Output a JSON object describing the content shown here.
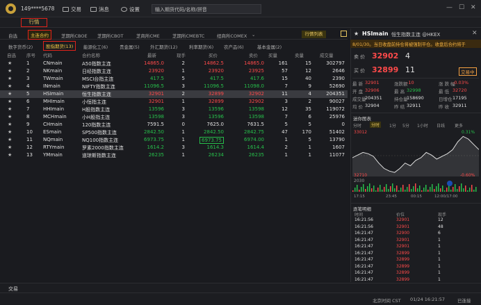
{
  "top": {
    "account": "149****5678",
    "trade": "交易",
    "message": "消息",
    "settings": "设置",
    "search_placeholder": "输入期货代码/名称/拼音"
  },
  "tab_main": "行情",
  "exchanges": [
    "自选",
    "主连合约",
    "芝期所CBOE",
    "芝期所CBOT",
    "芝商所CME",
    "芝期所CMEBTC",
    "纽商所COMEX"
  ],
  "list_label": "行情列表",
  "categories": [
    "数字货币(2)",
    "股指期货(13)",
    "能源化工(6)",
    "贵金属(5)",
    "外汇期货(12)",
    "利率期货(6)",
    "农产品(6)",
    "基本金属(2)"
  ],
  "headers": [
    "自选",
    "序号",
    "代码",
    "合约名称",
    "最新",
    "现手",
    "买价",
    "卖价",
    "买量",
    "卖量",
    "成交量"
  ],
  "rows": [
    {
      "no": "1",
      "code": "CNmain",
      "name": "A50指数主连",
      "last": "14865.0",
      "lc": "red",
      "hand": "2",
      "bid": "14862.5",
      "ask": "14865.0",
      "bq": "161",
      "aq": "15",
      "vol": "302797"
    },
    {
      "no": "2",
      "code": "NKmain",
      "name": "日经指数主连",
      "last": "23920",
      "lc": "red",
      "hand": "1",
      "bid": "23920",
      "ask": "23925",
      "bq": "57",
      "aq": "12",
      "vol": "2646"
    },
    {
      "no": "3",
      "code": "TWmain",
      "name": "MSCI台指主连",
      "last": "417.5",
      "lc": "grn",
      "hand": "5",
      "bid": "417.5",
      "ask": "417.6",
      "bq": "15",
      "aq": "40",
      "vol": "2390"
    },
    {
      "no": "4",
      "code": "INmain",
      "name": "NIFTY指数主连",
      "last": "11096.5",
      "lc": "grn",
      "hand": "3",
      "bid": "11096.5",
      "ask": "11098.0",
      "bq": "7",
      "aq": "9",
      "vol": "52690"
    },
    {
      "no": "5",
      "code": "HSImain",
      "name": "恒生指数主连",
      "last": "32901",
      "lc": "red",
      "hand": "2",
      "bid": "32899",
      "ask": "32902",
      "bq": "11",
      "aq": "4",
      "vol": "204351"
    },
    {
      "no": "6",
      "code": "MHImain",
      "name": "小恒指主连",
      "last": "32901",
      "lc": "red",
      "hand": "1",
      "bid": "32899",
      "ask": "32902",
      "bq": "3",
      "aq": "2",
      "vol": "90027"
    },
    {
      "no": "7",
      "code": "HHImain",
      "name": "H股指数主连",
      "last": "13596",
      "lc": "grn",
      "hand": "3",
      "bid": "13596",
      "ask": "13598",
      "bq": "12",
      "aq": "35",
      "vol": "119072"
    },
    {
      "no": "8",
      "code": "MCHmain",
      "name": "小H股指主连",
      "last": "13598",
      "lc": "grn",
      "hand": "3",
      "bid": "13596",
      "ask": "13598",
      "bq": "7",
      "aq": "6",
      "vol": "25976"
    },
    {
      "no": "9",
      "code": "CHmain",
      "name": "120指数主连",
      "last": "7591.5",
      "lc": "wht",
      "hand": "0",
      "bid": "7625.0",
      "ask": "7631.5",
      "bq": "5",
      "aq": "5",
      "vol": "0"
    },
    {
      "no": "10",
      "code": "ESmain",
      "name": "SP500指数主连",
      "last": "2842.50",
      "lc": "grn",
      "hand": "1",
      "bid": "2842.50",
      "ask": "2842.75",
      "bq": "47",
      "aq": "170",
      "vol": "51402"
    },
    {
      "no": "11",
      "code": "NQmain",
      "name": "NQ100指数主连",
      "last": "6973.75",
      "lc": "grn",
      "hand": "1",
      "bid": "6973.75",
      "ask": "6974.00",
      "bq": "1",
      "aq": "5",
      "vol": "13790"
    },
    {
      "no": "12",
      "code": "RTYmain",
      "name": "罗素2000指数主连",
      "last": "1614.2",
      "lc": "grn",
      "hand": "3",
      "bid": "1614.3",
      "ask": "1614.4",
      "bq": "2",
      "aq": "1",
      "vol": "1607"
    },
    {
      "no": "13",
      "code": "YMmain",
      "name": "道琼斯指数主连",
      "last": "26235",
      "lc": "grn",
      "hand": "1",
      "bid": "26234",
      "ask": "26235",
      "bq": "1",
      "aq": "1",
      "vol": "11077"
    }
  ],
  "right": {
    "code": "HSImain",
    "name": "恒生指数主连 @HKEX",
    "notice": "8/01/30。当日收盘前持仓将被强制平仓。收盘后合约将于",
    "sell_label": "卖 价",
    "sell": "32902",
    "sell_q": "4",
    "buy_label": "买 价",
    "buy": "32899",
    "buy_q": "11",
    "trade_btn": "交易中",
    "stats": [
      [
        "最 新",
        "32901",
        "涨跌额",
        "-10",
        "涨 跌 幅",
        "-0.03%"
      ],
      [
        "开 盘",
        "32906",
        "最 高",
        "32998",
        "最 低",
        "32720"
      ],
      [
        "成交量",
        "204351",
        "持仓量",
        "158690",
        "日增仓",
        "17195"
      ],
      [
        "均 价",
        "32904",
        "昨 结",
        "32911",
        "昨 收",
        "32911"
      ]
    ],
    "chart_title": "迷你图表",
    "chart_tabs": [
      "分时",
      "分时",
      "1分",
      "5分",
      "1小时",
      "日线",
      "更多"
    ],
    "chart_hi": "33012",
    "chart_hi_pct": "0.31%",
    "chart_lo": "32710",
    "chart_lo_pct": "-0.60%",
    "chart_vol": "2030",
    "chart_times": [
      "17:15",
      "23:45",
      "00:15",
      "12:00/17:00"
    ],
    "ticks_title": "逐笔明细",
    "ticks_headers": [
      "时间",
      "价位",
      "现手"
    ],
    "ticks": [
      [
        "16:21:56",
        "32901",
        "12"
      ],
      [
        "16:21:56",
        "32901",
        "48"
      ],
      [
        "16:21:47",
        "32900",
        "6"
      ],
      [
        "16:21:47",
        "32901",
        "1"
      ],
      [
        "16:21:47",
        "32901",
        "1"
      ],
      [
        "16:21:47",
        "32899",
        "1"
      ],
      [
        "16:21:47",
        "32899",
        "1"
      ],
      [
        "16:21:47",
        "32899",
        "1"
      ],
      [
        "16:21:47",
        "32899",
        "1"
      ],
      [
        "16:21:47",
        "32899",
        "1"
      ]
    ]
  },
  "bottom": {
    "trade": "交易",
    "time_label": "北京时间 CST",
    "datetime": "01/24 16:21:57",
    "status": "已连接"
  },
  "chart_data": {
    "type": "line",
    "x": [
      "17:15",
      "23:45",
      "00:15",
      "12:00/17:00"
    ],
    "ylim": [
      32710,
      33012
    ],
    "series": [
      {
        "values": [
          32840,
          32860,
          32880,
          32870,
          32850,
          32800,
          32760,
          32740,
          32730,
          32760,
          32800,
          32780,
          32820,
          32840,
          32880,
          32860,
          32830,
          32850,
          32870,
          32900,
          32960,
          33000,
          32980,
          32940,
          32901
        ]
      }
    ]
  }
}
